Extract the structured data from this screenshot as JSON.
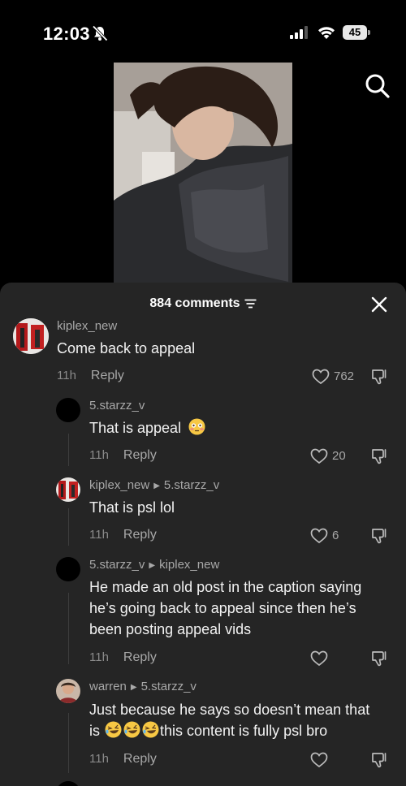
{
  "status_bar": {
    "time": "12:03",
    "battery": "45"
  },
  "sheet": {
    "comment_count": "884 comments"
  },
  "comments": [
    {
      "user": "kiplex_new",
      "text": "Come back to appeal",
      "age": "11h",
      "reply_label": "Reply",
      "likes": "762"
    },
    {
      "user": "5.starzz_v",
      "text": "That is appeal",
      "emoji": "flushed-face",
      "age": "11h",
      "reply_label": "Reply",
      "likes": "20"
    },
    {
      "user": "kiplex_new",
      "reply_to": "5.starzz_v",
      "text": "That is psl lol",
      "age": "11h",
      "reply_label": "Reply",
      "likes": "6"
    },
    {
      "user": "5.starzz_v",
      "reply_to": "kiplex_new",
      "text_line1": "He made an old post in the caption saying",
      "text_line2": "he’s going back to appeal since then he’s",
      "text_line3": "been posting appeal vids",
      "age": "11h",
      "reply_label": "Reply",
      "likes": ""
    },
    {
      "user": "warren",
      "reply_to": "5.starzz_v",
      "text_line1": "Just because he says so doesn’t mean that",
      "text_line2_pre": "is ",
      "text_line2_post": "this content is fully psl bro",
      "emoji": "rolling-on-floor-laughing",
      "age": "11h",
      "reply_label": "Reply",
      "likes": ""
    }
  ],
  "colors": {
    "sheet_bg": "#252525",
    "text_primary": "#f2f2f2",
    "text_secondary": "#a8a8a8"
  }
}
